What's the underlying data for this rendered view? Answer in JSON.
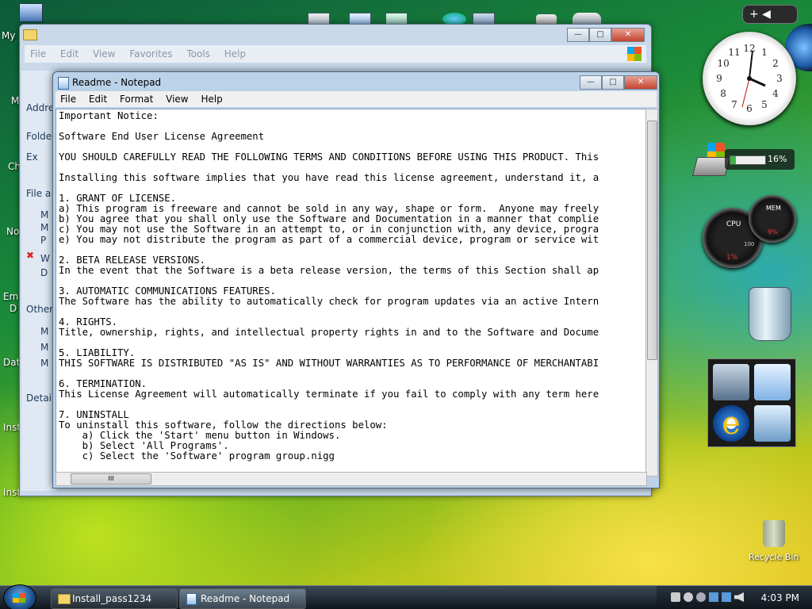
{
  "desktop": {
    "labels": [
      "My",
      "M",
      "Ch",
      "No",
      "Em",
      "D",
      "Dat",
      "Inst",
      "Inst"
    ],
    "recycle_bin": "Recycle Bin"
  },
  "explorer": {
    "menu": [
      "File",
      "Edit",
      "View",
      "Favorites",
      "Tools",
      "Help"
    ],
    "address_label": "Address",
    "side": [
      "Folde",
      "Ex",
      "File a",
      "M",
      "M",
      "P",
      "W",
      "D",
      "Other",
      "M",
      "M",
      "M",
      "Detai"
    ]
  },
  "notepad": {
    "title": "Readme - Notepad",
    "menu": [
      "File",
      "Edit",
      "Format",
      "View",
      "Help"
    ],
    "lines": [
      "Important Notice:",
      "",
      "Software End User License Agreement",
      "",
      "YOU SHOULD CAREFULLY READ THE FOLLOWING TERMS AND CONDITIONS BEFORE USING THIS PRODUCT. This",
      "",
      "Installing this software implies that you have read this license agreement, understand it, a",
      "",
      "1. GRANT OF LICENSE.",
      "a) This program is freeware and cannot be sold in any way, shape or form.  Anyone may freely",
      "b) You agree that you shall only use the Software and Documentation in a manner that complie",
      "c) You may not use the Software in an attempt to, or in conjunction with, any device, progra",
      "e) You may not distribute the program as part of a commercial device, program or service wit",
      "",
      "2. BETA RELEASE VERSIONS.",
      "In the event that the Software is a beta release version, the terms of this Section shall ap",
      "",
      "3. AUTOMATIC COMMUNICATIONS FEATURES.",
      "The Software has the ability to automatically check for program updates via an active Intern",
      "",
      "4. RIGHTS.",
      "Title, ownership, rights, and intellectual property rights in and to the Software and Docume",
      "",
      "5. LIABILITY.",
      "THIS SOFTWARE IS DISTRIBUTED \"AS IS\" AND WITHOUT WARRANTIES AS TO PERFORMANCE OF MERCHANTABI",
      "",
      "6. TERMINATION.",
      "This License Agreement will automatically terminate if you fail to comply with any term here",
      "",
      "7. UNINSTALL",
      "To uninstall this software, follow the directions below:",
      "    a) Click the 'Start' menu button in Windows.",
      "    b) Select 'All Programs'.",
      "    c) Select the 'Software' program group.nigg"
    ],
    "hscroll_grip": "III"
  },
  "gadgets": {
    "clock_numbers": [
      "12",
      "1",
      "2",
      "3",
      "4",
      "5",
      "6",
      "7",
      "8",
      "9",
      "10",
      "11"
    ],
    "drive_percent": "16%",
    "drive_level": 0.16,
    "cpu_label": "CPU",
    "mem_label": "MEM",
    "cpu_value": "1%",
    "mem_value": "9%",
    "cpu_max": "100"
  },
  "taskbar": {
    "tasks": [
      "Install_pass1234",
      "Readme - Notepad"
    ],
    "time": "4:03 PM"
  },
  "colors": {
    "accent": "#1c4f8c",
    "close": "#c4442f"
  }
}
